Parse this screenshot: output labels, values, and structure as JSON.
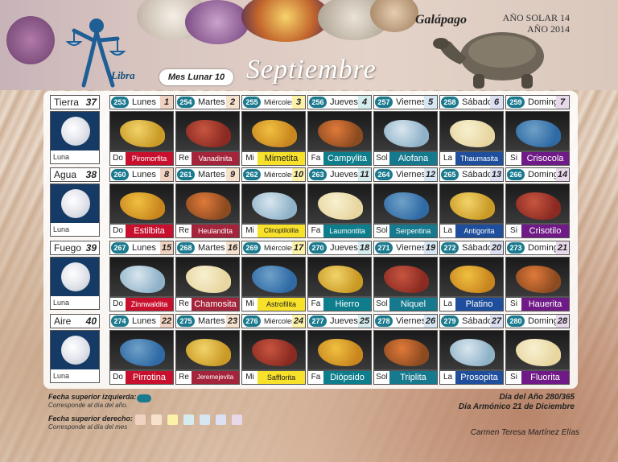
{
  "header": {
    "zodiac": "Libra",
    "mes_lunar": "Mes Lunar 10",
    "month": "Septiembre",
    "tribe": "Galápago",
    "ano_solar": "AÑO SOLAR 14",
    "ano": "AÑO 2014"
  },
  "colors": {
    "badge": "#1b7a8e",
    "plasma_colors": {
      "Do": "#c8102e",
      "Re": "#a4243b",
      "Mi": "#f7e12a",
      "Fa": "#0e7e8c",
      "Sol": "#16798e",
      "La": "#1f4f9c",
      "Si": "#6f1a86"
    }
  },
  "weeks": [
    {
      "name": "Tierra",
      "num": "37",
      "moon": "Luna",
      "days": [
        {
          "badge": "253",
          "name": "Lunes",
          "num": "1",
          "plasma": "Do",
          "mineral": "Piromorfita",
          "num_bg": "#f0d2c2"
        },
        {
          "badge": "254",
          "name": "Martes",
          "num": "2",
          "plasma": "Re",
          "mineral": "Vanadinita",
          "num_bg": "#f6e2cc"
        },
        {
          "badge": "255",
          "name": "Miércoles",
          "num": "3",
          "plasma": "Mi",
          "mineral": "Mimetita",
          "num_bg": "#fbf1a8"
        },
        {
          "badge": "256",
          "name": "Jueves",
          "num": "4",
          "plasma": "Fa",
          "mineral": "Campylita",
          "num_bg": "#d5ecef"
        },
        {
          "badge": "257",
          "name": "Viernes",
          "num": "5",
          "plasma": "Sol",
          "mineral": "Alofana",
          "num_bg": "#d6e6f2"
        },
        {
          "badge": "258",
          "name": "Sábado",
          "num": "6",
          "plasma": "La",
          "mineral": "Thaumasita",
          "num_bg": "#dde0f2"
        },
        {
          "badge": "259",
          "name": "Domingo",
          "num": "7",
          "plasma": "Si",
          "mineral": "Crisocola",
          "num_bg": "#e7d8ea"
        }
      ]
    },
    {
      "name": "Agua",
      "num": "38",
      "moon": "Luna",
      "days": [
        {
          "badge": "260",
          "name": "Lunes",
          "num": "8",
          "plasma": "Do",
          "mineral": "Estilbita",
          "num_bg": "#f0d2c2"
        },
        {
          "badge": "261",
          "name": "Martes",
          "num": "9",
          "plasma": "Re",
          "mineral": "Heulandita",
          "num_bg": "#f6e2cc"
        },
        {
          "badge": "262",
          "name": "Miércoles",
          "num": "10",
          "plasma": "Mi",
          "mineral": "Clinoptilolita",
          "num_bg": "#fbf1a8"
        },
        {
          "badge": "263",
          "name": "Jueves",
          "num": "11",
          "plasma": "Fa",
          "mineral": "Laumontita",
          "num_bg": "#d5ecef"
        },
        {
          "badge": "264",
          "name": "Viernes",
          "num": "12",
          "plasma": "Sol",
          "mineral": "Serpentina",
          "num_bg": "#d6e6f2"
        },
        {
          "badge": "265",
          "name": "Sábado",
          "num": "13",
          "plasma": "La",
          "mineral": "Antigorita",
          "num_bg": "#dde0f2"
        },
        {
          "badge": "266",
          "name": "Domingo",
          "num": "14",
          "plasma": "Si",
          "mineral": "Crisotilo",
          "num_bg": "#e7d8ea"
        }
      ]
    },
    {
      "name": "Fuego",
      "num": "39",
      "moon": "Luna",
      "days": [
        {
          "badge": "267",
          "name": "Lunes",
          "num": "15",
          "plasma": "Do",
          "mineral": "Zinnwaldita",
          "num_bg": "#f0d2c2"
        },
        {
          "badge": "268",
          "name": "Martes",
          "num": "16",
          "plasma": "Re",
          "mineral": "Chamosita",
          "num_bg": "#f6e2cc"
        },
        {
          "badge": "269",
          "name": "Miércoles",
          "num": "17",
          "plasma": "Mi",
          "mineral": "Astrofilita",
          "num_bg": "#fbf1a8"
        },
        {
          "badge": "270",
          "name": "Jueves",
          "num": "18",
          "plasma": "Fa",
          "mineral": "Hierro",
          "num_bg": "#d5ecef"
        },
        {
          "badge": "271",
          "name": "Viernes",
          "num": "19",
          "plasma": "Sol",
          "mineral": "Niquel",
          "num_bg": "#d6e6f2"
        },
        {
          "badge": "272",
          "name": "Sábado",
          "num": "20",
          "plasma": "La",
          "mineral": "Platino",
          "num_bg": "#dde0f2"
        },
        {
          "badge": "273",
          "name": "Domingo",
          "num": "21",
          "plasma": "Si",
          "mineral": "Hauerita",
          "num_bg": "#e7d8ea"
        }
      ]
    },
    {
      "name": "Aire",
      "num": "40",
      "moon": "Luna",
      "days": [
        {
          "badge": "274",
          "name": "Lunes",
          "num": "22",
          "plasma": "Do",
          "mineral": "Pirrotina",
          "num_bg": "#f0d2c2"
        },
        {
          "badge": "275",
          "name": "Martes",
          "num": "23",
          "plasma": "Re",
          "mineral": "Jeremejevita",
          "num_bg": "#f6e2cc"
        },
        {
          "badge": "276",
          "name": "Miércoles",
          "num": "24",
          "plasma": "Mi",
          "mineral": "Safflorita",
          "num_bg": "#fbf1a8"
        },
        {
          "badge": "277",
          "name": "Jueves",
          "num": "25",
          "plasma": "Fa",
          "mineral": "Diópsido",
          "num_bg": "#d5ecef"
        },
        {
          "badge": "278",
          "name": "Viernes",
          "num": "26",
          "plasma": "Sol",
          "mineral": "Triplita",
          "num_bg": "#d6e6f2"
        },
        {
          "badge": "279",
          "name": "Sábado",
          "num": "27",
          "plasma": "La",
          "mineral": "Prosopita",
          "num_bg": "#dde0f2"
        },
        {
          "badge": "280",
          "name": "Domingo",
          "num": "28",
          "plasma": "Si",
          "mineral": "Fluorita",
          "num_bg": "#e7d8ea"
        }
      ]
    }
  ],
  "footer": {
    "legend_left_title": "Fecha superior izquierda:",
    "legend_left_text": "Corresponde al día del año.",
    "legend_right_title": "Fecha superior derecho:",
    "legend_right_text": "Corresponde al día del mes",
    "day_of_year": "Día del Año 280/365",
    "dia_armonico": "Día Armónico 21 de Diciembre",
    "author": "Carmen Teresa Martínez Elías"
  }
}
